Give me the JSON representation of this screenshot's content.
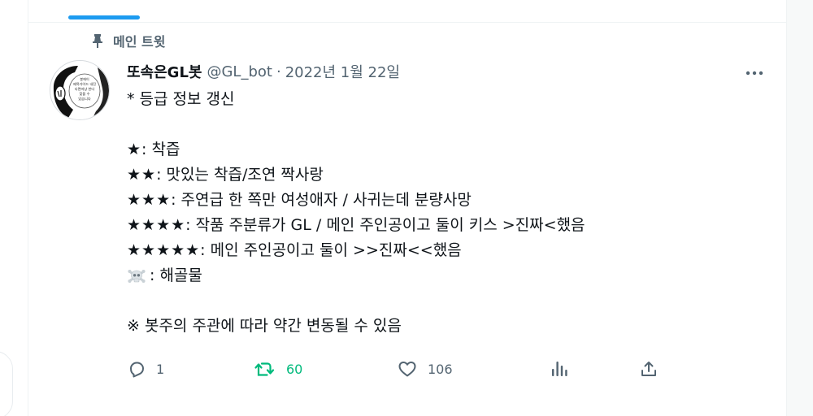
{
  "pinned_label": "메인 트윗",
  "tweet": {
    "display_name": "또속은GL봇",
    "handle": "@GL_bot",
    "separator": "·",
    "date": "2022년 1월 22일",
    "avatar_text": [
      "봉에이",
      "제목가이드 내진",
      "다면마냥 한다",
      "찾을 수",
      "있습니다"
    ],
    "lines": {
      "l1": "* 등급 정보 갱신",
      "s1": {
        "stars": "★",
        "text": " : 착즙"
      },
      "s2": {
        "stars": "★★",
        "text": " : 맛있는 착즙/조연 짝사랑"
      },
      "s3": {
        "stars": "★★★",
        "text": " : 주연급 한 쪽만 여성애자 / 사귀는데 분량사망"
      },
      "s4": {
        "stars": "★★★★",
        "text": " : 작품 주분류가 GL / 메인 주인공이고 둘이 키스 >진짜<했음"
      },
      "s5": {
        "stars": "★★★★★",
        "text": " : 메인 주인공이고 둘이 >>진짜<<했음"
      },
      "skull": " : 해골물",
      "note": "※ 봇주의 주관에 따라 약간 변동될 수 있음"
    }
  },
  "actions": {
    "reply_count": "1",
    "retweet_count": "60",
    "like_count": "106"
  },
  "colors": {
    "accent": "#1d9bf0",
    "retweet_green": "#00ba7c",
    "secondary_text": "#536471"
  },
  "icons": [
    "pin-icon",
    "more-icon",
    "skull-crossbones-icon",
    "reply-icon",
    "retweet-icon",
    "like-icon",
    "views-icon",
    "share-icon"
  ]
}
